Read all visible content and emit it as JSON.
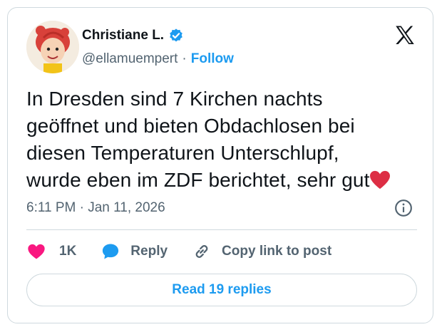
{
  "author": {
    "name": "Christiane L.",
    "handle": "@ellamuempert",
    "separator": "·",
    "follow_label": "Follow",
    "verified": true,
    "avatar_icon": "cartoon-redhead-avatar"
  },
  "tweet": {
    "lines": [
      "In Dresden sind 7 Kirchen nachts",
      "geöffnet und bieten Obdachlosen bei",
      "diesen Temperaturen Unterschlupf,",
      "wurde eben im ZDF berichtet, sehr gut"
    ],
    "trailing_emoji": "red-heart-emoji",
    "timestamp": "6:11 PM · Jan 11, 2026"
  },
  "actions": {
    "like_count": "1K",
    "reply_label": "Reply",
    "copy_label": "Copy link to post"
  },
  "read_replies_label": "Read 19 replies",
  "colors": {
    "accent": "#1d9bf0",
    "like": "#f91880",
    "reply_icon": "#1d9bf0",
    "text": "#0f1419",
    "muted": "#536471",
    "border": "#cfd9de"
  }
}
